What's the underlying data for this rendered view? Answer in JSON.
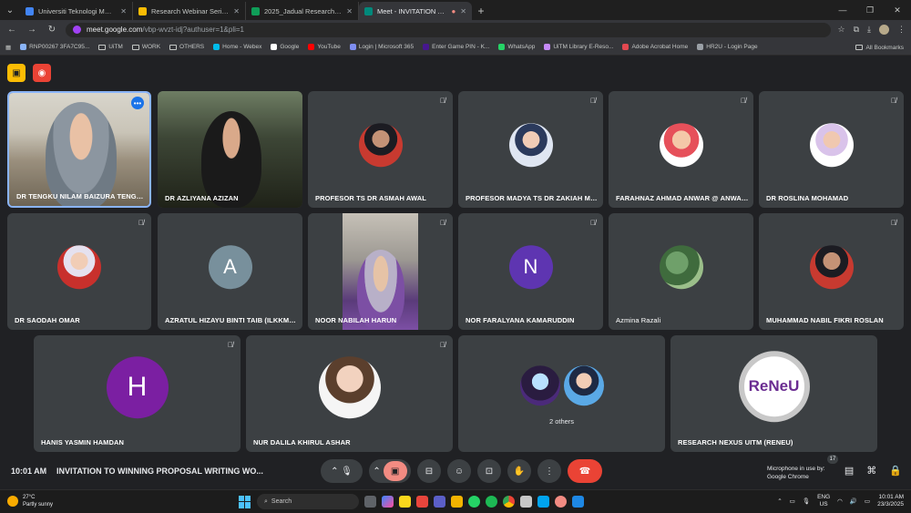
{
  "browser": {
    "tabs": [
      {
        "label": "Universiti Teknologi MARA - Ca",
        "color": "#4285f4"
      },
      {
        "label": "Research Webinar Series 7.0 20",
        "color": "#fbbc04"
      },
      {
        "label": "2025_Jadual Research Webinar",
        "color": "#0f9d58"
      },
      {
        "label": "Meet - INVITATION TO WI",
        "color": "#00897b",
        "active": true
      }
    ],
    "new_tab": "+",
    "address": {
      "host": "meet.google.com",
      "path": "/vbp-wvzt-idj?authuser=1&pli=1"
    },
    "bookmarks": [
      "RNP00267 3FA7C95...",
      "UiTM",
      "WORK",
      "OTHERS",
      "Home - Webex",
      "Google",
      "YouTube",
      "Login | Microsoft 365",
      "Enter Game PIN - K...",
      "WhatsApp",
      "UiTM Library E-Reso...",
      "Adobe Acrobat Home",
      "HR2U - Login Page"
    ],
    "all_bookmarks": "All Bookmarks"
  },
  "participants": [
    {
      "name": "DR TENGKU NILAM BAIZURA TENGKU I...",
      "kind": "video-office"
    },
    {
      "name": "DR AZLIYANA AZIZAN",
      "kind": "video-dark"
    },
    {
      "name": "PROFESOR TS DR ASMAH AWAL",
      "kind": "photo",
      "style": "f"
    },
    {
      "name": "PROFESOR MADYA TS DR ZAKIAH MOH...",
      "kind": "photo",
      "style": "h"
    },
    {
      "name": "FARAHNAZ AHMAD ANWAR @ ANWAR ...",
      "kind": "photo",
      "style": "c"
    },
    {
      "name": "DR ROSLINA MOHAMAD",
      "kind": "photo",
      "style": "b"
    },
    {
      "name": "DR SAODAH OMAR",
      "kind": "photo",
      "style": "d"
    },
    {
      "name": "AZRATUL HIZAYU BINTI TAIB (ILKKMSG...",
      "kind": "letter",
      "letter": "A",
      "color": "#78909c"
    },
    {
      "name": "NOOR NABILAH HARUN",
      "kind": "video-purple"
    },
    {
      "name": "NOR FARALYANA KAMARUDDIN",
      "kind": "letter",
      "letter": "N",
      "color": "#5e35b1"
    },
    {
      "name": "Azmina Razali",
      "kind": "photo",
      "style": "e"
    },
    {
      "name": "MUHAMMAD NABIL FIKRI ROSLAN",
      "kind": "photo",
      "style": "f"
    },
    {
      "name": "HANIS YASMIN HAMDAN",
      "kind": "letter",
      "letter": "H",
      "color": "#7b1fa2"
    },
    {
      "name": "NUR DALILA KHIRUL ASHAR",
      "kind": "photo",
      "style": "g"
    },
    {
      "name": "",
      "kind": "others",
      "label": "2 others"
    },
    {
      "name": "RESEARCH NEXUS UITM (RENEU)",
      "kind": "logo",
      "logo_text": "ReNeU"
    }
  ],
  "bottom": {
    "time": "10:01 AM",
    "title": "INVITATION TO WINNING PROPOSAL WRITING WO...",
    "mic_notice_1": "Microphone in use by:",
    "mic_notice_2": "Google Chrome",
    "participant_count": "17"
  },
  "taskbar": {
    "temp": "27°C",
    "weather": "Partly sunny",
    "search": "Search",
    "lang1": "ENG",
    "lang2": "US",
    "time": "10:01 AM",
    "date": "23/3/2025"
  }
}
